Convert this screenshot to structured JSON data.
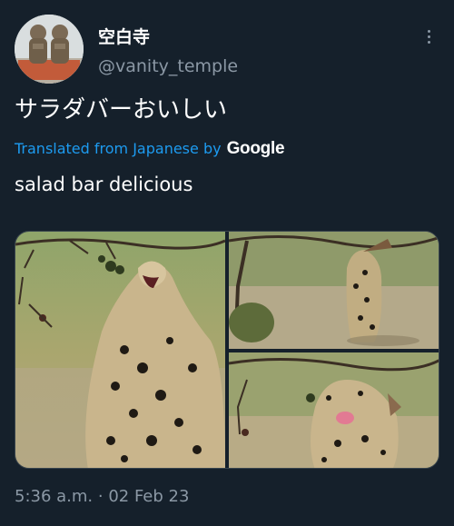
{
  "user": {
    "display_name": "空白寺",
    "handle": "@vanity_temple",
    "avatar_icon": "stone-statues-avatar"
  },
  "tweet": {
    "text": "サラダバーおいしい",
    "translated_label": "Translated from Japanese by",
    "translation_provider": "Google",
    "translation": "salad bar delicious",
    "timestamp": "5:36 a.m. · 02 Feb 23"
  },
  "icons": {
    "more": "more-options-icon"
  },
  "colors": {
    "background": "#15202b",
    "link": "#1d9bf0",
    "secondary_text": "#8b98a5"
  }
}
